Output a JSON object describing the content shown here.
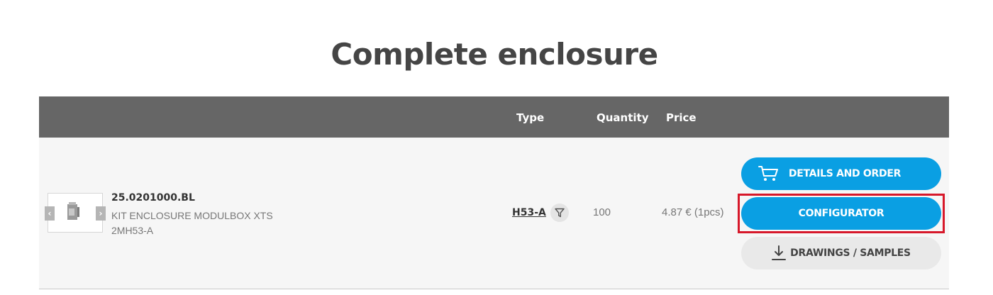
{
  "page": {
    "title": "Complete enclosure"
  },
  "table": {
    "headers": {
      "type": "Type",
      "quantity": "Quantity",
      "price": "Price"
    },
    "row": {
      "code": "25.0201000.BL",
      "description": "KIT ENCLOSURE MODULBOX XTS 2MH53-A",
      "type": "H53-A",
      "quantity": "100",
      "price": "4.87 € (1pcs)"
    }
  },
  "buttons": {
    "details": "DETAILS AND ORDER",
    "configurator": "CONFIGURATOR",
    "drawings": "DRAWINGS / SAMPLES"
  },
  "gallery": {
    "prev": "‹",
    "next": "›"
  },
  "icons": {
    "cart": "cart-icon",
    "download": "download-icon",
    "filter": "filter-icon"
  },
  "colors": {
    "accent": "#0a9fe3",
    "header_bg": "#666666",
    "row_bg": "#f6f6f6",
    "highlight": "#d7182a"
  }
}
